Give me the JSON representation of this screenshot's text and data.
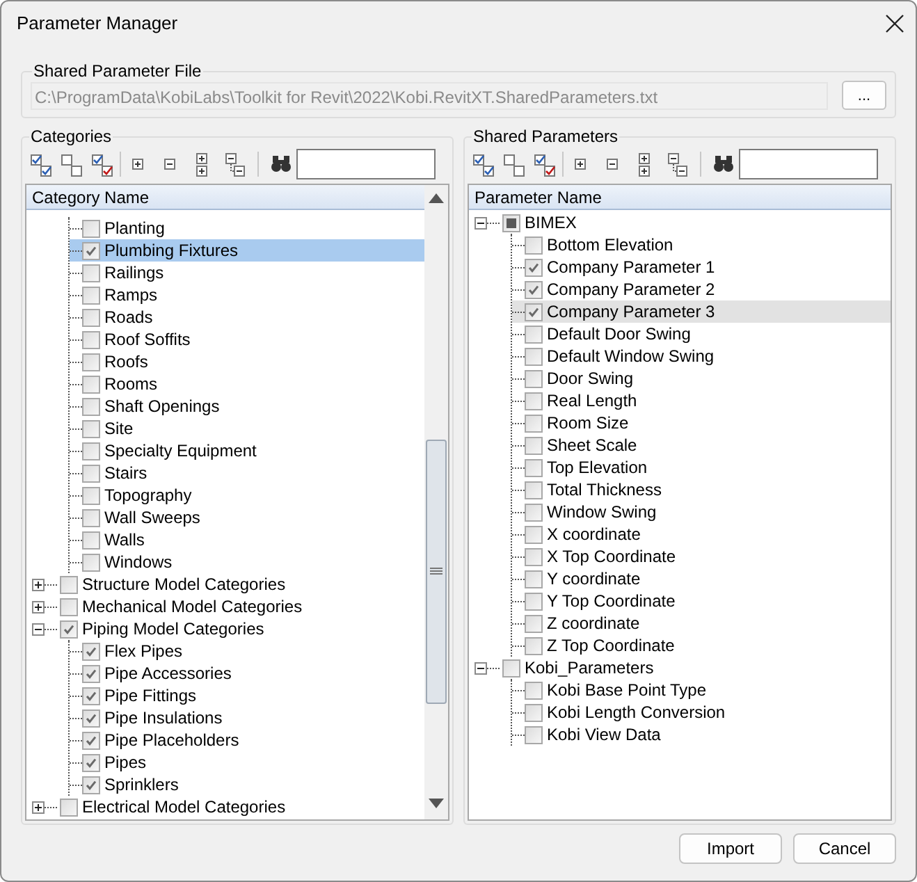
{
  "window": {
    "title": "Parameter Manager"
  },
  "shared_parameter_file": {
    "label": "Shared Parameter File",
    "path": "C:\\ProgramData\\KobiLabs\\Toolkit for Revit\\2022\\Kobi.RevitXT.SharedParameters.txt",
    "disabled": true,
    "browse_button": "..."
  },
  "categories": {
    "label": "Categories",
    "column": "Category Name",
    "scrollbar": true,
    "tree": [
      {
        "children": [
          {
            "label": "Planting",
            "checked": false,
            "selected": false
          },
          {
            "label": "Plumbing Fixtures",
            "checked": true,
            "selected": true
          },
          {
            "label": "Railings",
            "checked": false,
            "selected": false
          },
          {
            "label": "Ramps",
            "checked": false,
            "selected": false
          },
          {
            "label": "Roads",
            "checked": false,
            "selected": false
          },
          {
            "label": "Roof Soffits",
            "checked": false,
            "selected": false
          },
          {
            "label": "Roofs",
            "checked": false,
            "selected": false
          },
          {
            "label": "Rooms",
            "checked": false,
            "selected": false
          },
          {
            "label": "Shaft Openings",
            "checked": false,
            "selected": false
          },
          {
            "label": "Site",
            "checked": false,
            "selected": false
          },
          {
            "label": "Specialty Equipment",
            "checked": false,
            "selected": false
          },
          {
            "label": "Stairs",
            "checked": false,
            "selected": false
          },
          {
            "label": "Topography",
            "checked": false,
            "selected": false
          },
          {
            "label": "Wall Sweeps",
            "checked": false,
            "selected": false
          },
          {
            "label": "Walls",
            "checked": false,
            "selected": false
          },
          {
            "label": "Windows",
            "checked": false,
            "selected": false
          }
        ]
      },
      {
        "label": "Structure Model Categories",
        "checked": false,
        "indeterminate": false,
        "selected": false,
        "expanded": false
      },
      {
        "label": "Mechanical Model Categories",
        "checked": false,
        "indeterminate": false,
        "selected": false,
        "expanded": false
      },
      {
        "label": "Piping Model Categories",
        "checked": true,
        "indeterminate": false,
        "selected": false,
        "expanded": true,
        "children": [
          {
            "label": "Flex Pipes",
            "checked": true,
            "selected": false
          },
          {
            "label": "Pipe Accessories",
            "checked": true,
            "selected": false
          },
          {
            "label": "Pipe Fittings",
            "checked": true,
            "selected": false
          },
          {
            "label": "Pipe Insulations",
            "checked": true,
            "selected": false
          },
          {
            "label": "Pipe Placeholders",
            "checked": true,
            "selected": false
          },
          {
            "label": "Pipes",
            "checked": true,
            "selected": false
          },
          {
            "label": "Sprinklers",
            "checked": true,
            "selected": false
          }
        ]
      },
      {
        "label": "Electrical Model Categories",
        "checked": false,
        "indeterminate": false,
        "selected": false,
        "expanded": false
      }
    ]
  },
  "shared_parameters": {
    "label": "Shared Parameters",
    "column": "Parameter Name",
    "scrollbar": false,
    "tree": [
      {
        "label": "BIMEX",
        "checked": false,
        "indeterminate": true,
        "selected": false,
        "expanded": true,
        "children": [
          {
            "label": "Bottom Elevation",
            "checked": false,
            "selected": false
          },
          {
            "label": "Company Parameter 1",
            "checked": true,
            "selected": false
          },
          {
            "label": "Company Parameter 2",
            "checked": true,
            "selected": false
          },
          {
            "label": "Company Parameter 3",
            "checked": true,
            "selected": true
          },
          {
            "label": "Default Door Swing",
            "checked": false,
            "selected": false
          },
          {
            "label": "Default Window Swing",
            "checked": false,
            "selected": false
          },
          {
            "label": "Door Swing",
            "checked": false,
            "selected": false
          },
          {
            "label": "Real Length",
            "checked": false,
            "selected": false
          },
          {
            "label": "Room Size",
            "checked": false,
            "selected": false
          },
          {
            "label": "Sheet Scale",
            "checked": false,
            "selected": false
          },
          {
            "label": "Top Elevation",
            "checked": false,
            "selected": false
          },
          {
            "label": "Total Thickness",
            "checked": false,
            "selected": false
          },
          {
            "label": "Window Swing",
            "checked": false,
            "selected": false
          },
          {
            "label": "X coordinate",
            "checked": false,
            "selected": false
          },
          {
            "label": "X Top Coordinate",
            "checked": false,
            "selected": false
          },
          {
            "label": "Y coordinate",
            "checked": false,
            "selected": false
          },
          {
            "label": "Y Top Coordinate",
            "checked": false,
            "selected": false
          },
          {
            "label": "Z coordinate",
            "checked": false,
            "selected": false
          },
          {
            "label": "Z Top Coordinate",
            "checked": false,
            "selected": false
          }
        ]
      },
      {
        "label": "Kobi_Parameters",
        "checked": false,
        "indeterminate": false,
        "selected": false,
        "expanded": true,
        "children": [
          {
            "label": "Kobi Base Point Type",
            "checked": false,
            "selected": false
          },
          {
            "label": "Kobi Length Conversion",
            "checked": false,
            "selected": false
          },
          {
            "label": "Kobi View Data",
            "checked": false,
            "selected": false
          }
        ]
      }
    ]
  },
  "buttons": [
    "Import",
    "Cancel"
  ]
}
